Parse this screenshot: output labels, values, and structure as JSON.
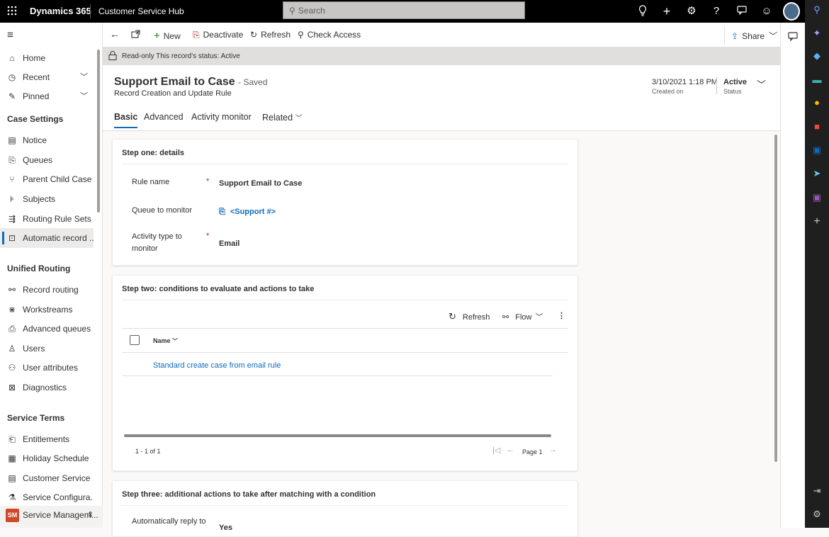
{
  "topbar": {
    "brand": "Dynamics 365",
    "app_name": "Customer Service Hub",
    "search_placeholder": "Search",
    "icons": [
      "waffle-icon",
      "lightbulb-icon",
      "plus-icon",
      "settings-icon",
      "help-icon",
      "chat-icon",
      "smiley-icon"
    ]
  },
  "commands": {
    "new": "New",
    "deactivate": "Deactivate",
    "refresh": "Refresh",
    "check_access": "Check Access",
    "share": "Share"
  },
  "readonly_notice": "Read-only This record's status: Active",
  "sidebar": {
    "items_top": [
      {
        "label": "Home",
        "icon": "home-icon"
      },
      {
        "label": "Recent",
        "icon": "clock-icon"
      },
      {
        "label": "Pinned",
        "icon": "pin-icon"
      }
    ],
    "groups": {
      "case_settings": "Case Settings",
      "unified_routing": "Unified Routing",
      "service_terms": "Service Terms"
    },
    "case_items": [
      {
        "label": "Notice",
        "icon": "notice-icon"
      },
      {
        "label": "Queues",
        "icon": "queue-icon"
      },
      {
        "label": "Parent Child Case ...",
        "icon": "parent-child-icon"
      },
      {
        "label": "Subjects",
        "icon": "subject-icon"
      },
      {
        "label": "Routing Rule Sets",
        "icon": "routing-icon"
      },
      {
        "label": "Automatic record ...",
        "icon": "auto-record-icon"
      }
    ],
    "routing_items": [
      {
        "label": "Record routing",
        "icon": "record-routing-icon"
      },
      {
        "label": "Workstreams",
        "icon": "workstream-icon"
      },
      {
        "label": "Advanced queues",
        "icon": "advanced-queue-icon"
      },
      {
        "label": "Users",
        "icon": "user-icon"
      },
      {
        "label": "User attributes",
        "icon": "user-attributes-icon"
      },
      {
        "label": "Diagnostics",
        "icon": "diagnostics-icon"
      }
    ],
    "terms_items": [
      {
        "label": "Entitlements",
        "icon": "entitlement-icon"
      },
      {
        "label": "Holiday Schedule",
        "icon": "calendar-icon"
      },
      {
        "label": "Customer Service ...",
        "icon": "customer-service-icon"
      },
      {
        "label": "Service Configura...",
        "icon": "service-config-icon"
      }
    ],
    "area_badge": "SM",
    "area_label": "Service Managem..."
  },
  "record": {
    "title": "Support Email to Case",
    "saved": "- Saved",
    "entity": "Record Creation and Update Rule",
    "created_on_value": "3/10/2021 1:18 PM",
    "created_on_label": "Created on",
    "status_value": "Active",
    "status_label": "Status"
  },
  "tabs": [
    "Basic",
    "Advanced",
    "Activity monitor",
    "Related"
  ],
  "step1": {
    "heading": "Step one: details",
    "rule_name_label": "Rule name",
    "rule_name_value": "Support Email to Case",
    "queue_label": "Queue to monitor",
    "queue_value": "<Support #>",
    "activity_label": "Activity type to monitor",
    "activity_value": "Email",
    "required_mark": "*"
  },
  "step2": {
    "heading": "Step two: conditions to evaluate and actions to take",
    "refresh": "Refresh",
    "flow": "Flow",
    "col_name": "Name",
    "rows": [
      "Standard create case from email rule"
    ],
    "count": "1 - 1 of 1",
    "page": "Page 1"
  },
  "step3": {
    "heading": "Step three: additional actions to take after matching with a condition",
    "auto_reply_label": "Automatically reply to",
    "auto_reply_value": "Yes"
  },
  "colors": {
    "accent": "#0f6cbd",
    "topbar": "#000000",
    "area_badge": "#d24726"
  }
}
